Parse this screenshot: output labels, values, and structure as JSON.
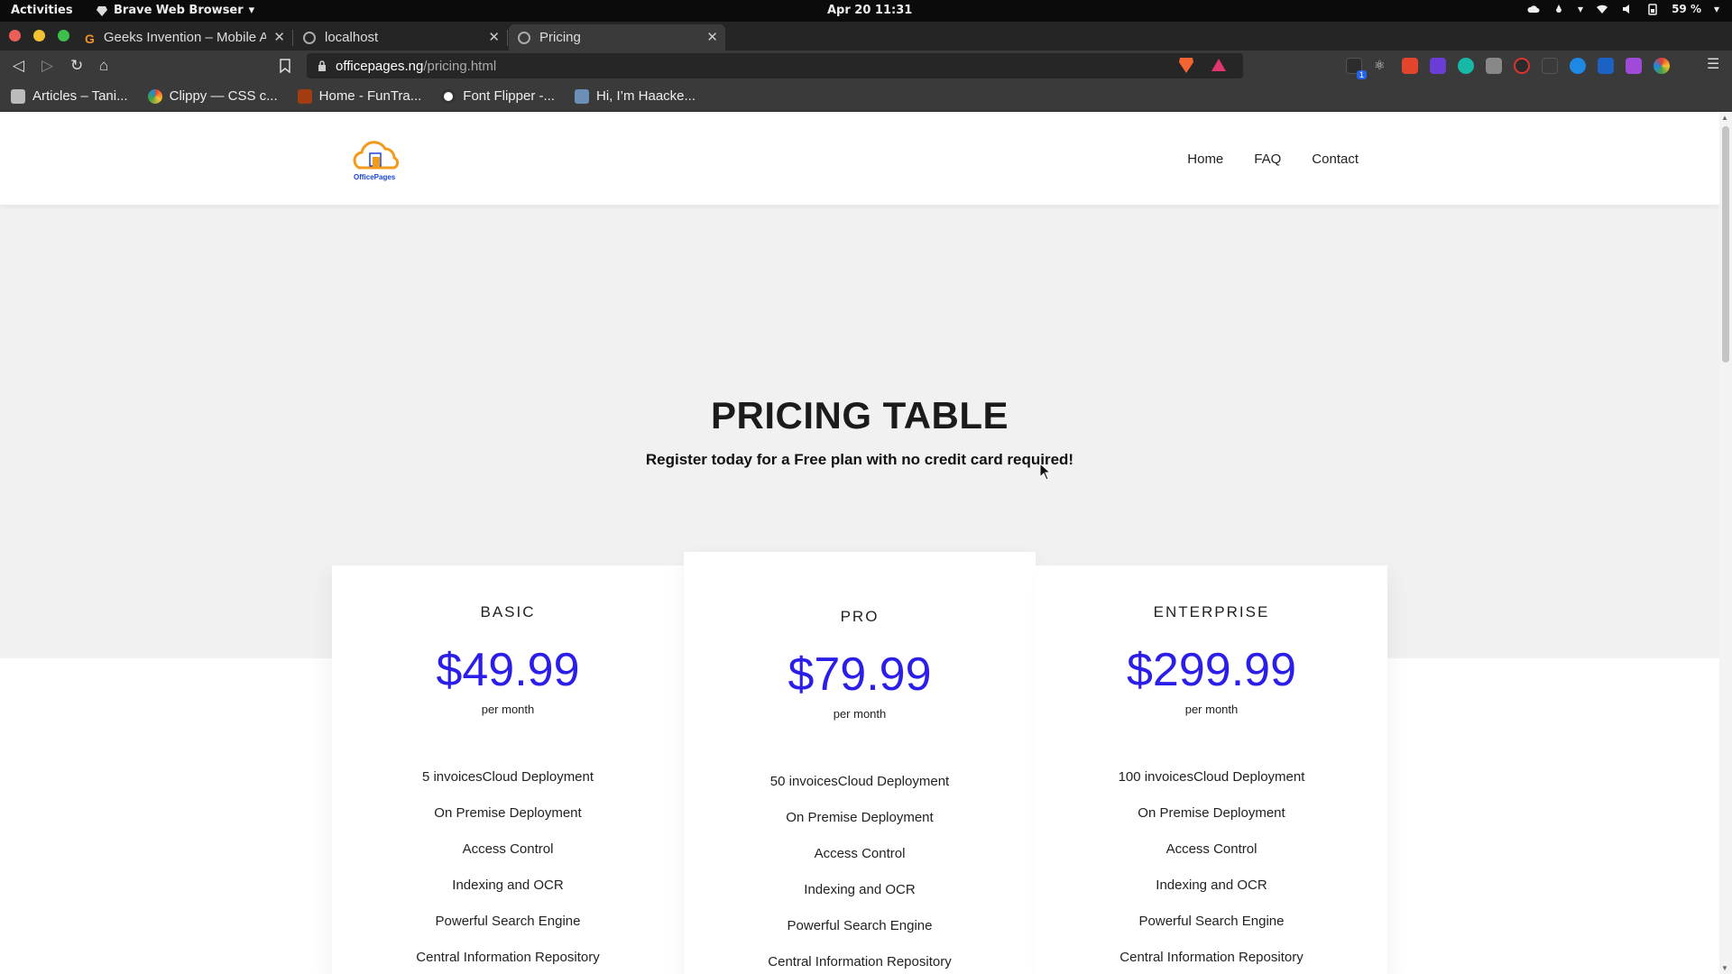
{
  "system": {
    "activities": "Activities",
    "app_name": "Brave Web Browser",
    "clock": "Apr 20  11:31",
    "battery": "59 %"
  },
  "tabs": [
    {
      "title": "Geeks Invention – Mobile A"
    },
    {
      "title": "localhost"
    },
    {
      "title": "Pricing"
    }
  ],
  "address_bar": {
    "host": "officepages.ng",
    "path": "/pricing.html"
  },
  "bookmarks": [
    {
      "label": "Articles – Tani..."
    },
    {
      "label": "Clippy — CSS c..."
    },
    {
      "label": "Home - FunTra..."
    },
    {
      "label": "Font Flipper -..."
    },
    {
      "label": "Hi, I’m Haacke..."
    }
  ],
  "extension_badge": "1",
  "site": {
    "logo_text": "OfficePages",
    "nav": [
      "Home",
      "FAQ",
      "Contact"
    ],
    "title": "PRICING TABLE",
    "subtitle": "Register today for a Free plan with no credit card required!"
  },
  "plans": [
    {
      "name": "BASIC",
      "price": "$49.99",
      "period": "per month",
      "features": [
        "5 invoicesCloud Deployment",
        "On Premise Deployment",
        "Access Control",
        "Indexing and OCR",
        "Powerful Search Engine",
        "Central Information Repository"
      ]
    },
    {
      "name": "PRO",
      "price": "$79.99",
      "period": "per month",
      "features": [
        "50 invoicesCloud Deployment",
        "On Premise Deployment",
        "Access Control",
        "Indexing and OCR",
        "Powerful Search Engine",
        "Central Information Repository"
      ]
    },
    {
      "name": "ENTERPRISE",
      "price": "$299.99",
      "period": "per month",
      "features": [
        "100 invoicesCloud Deployment",
        "On Premise Deployment",
        "Access Control",
        "Indexing and OCR",
        "Powerful Search Engine",
        "Central Information Repository"
      ]
    }
  ],
  "colors": {
    "price": "#2a1ee8",
    "hero_bg": "#f1f1f1",
    "logo_orange": "#f39a1b",
    "logo_blue": "#1a47d6"
  }
}
